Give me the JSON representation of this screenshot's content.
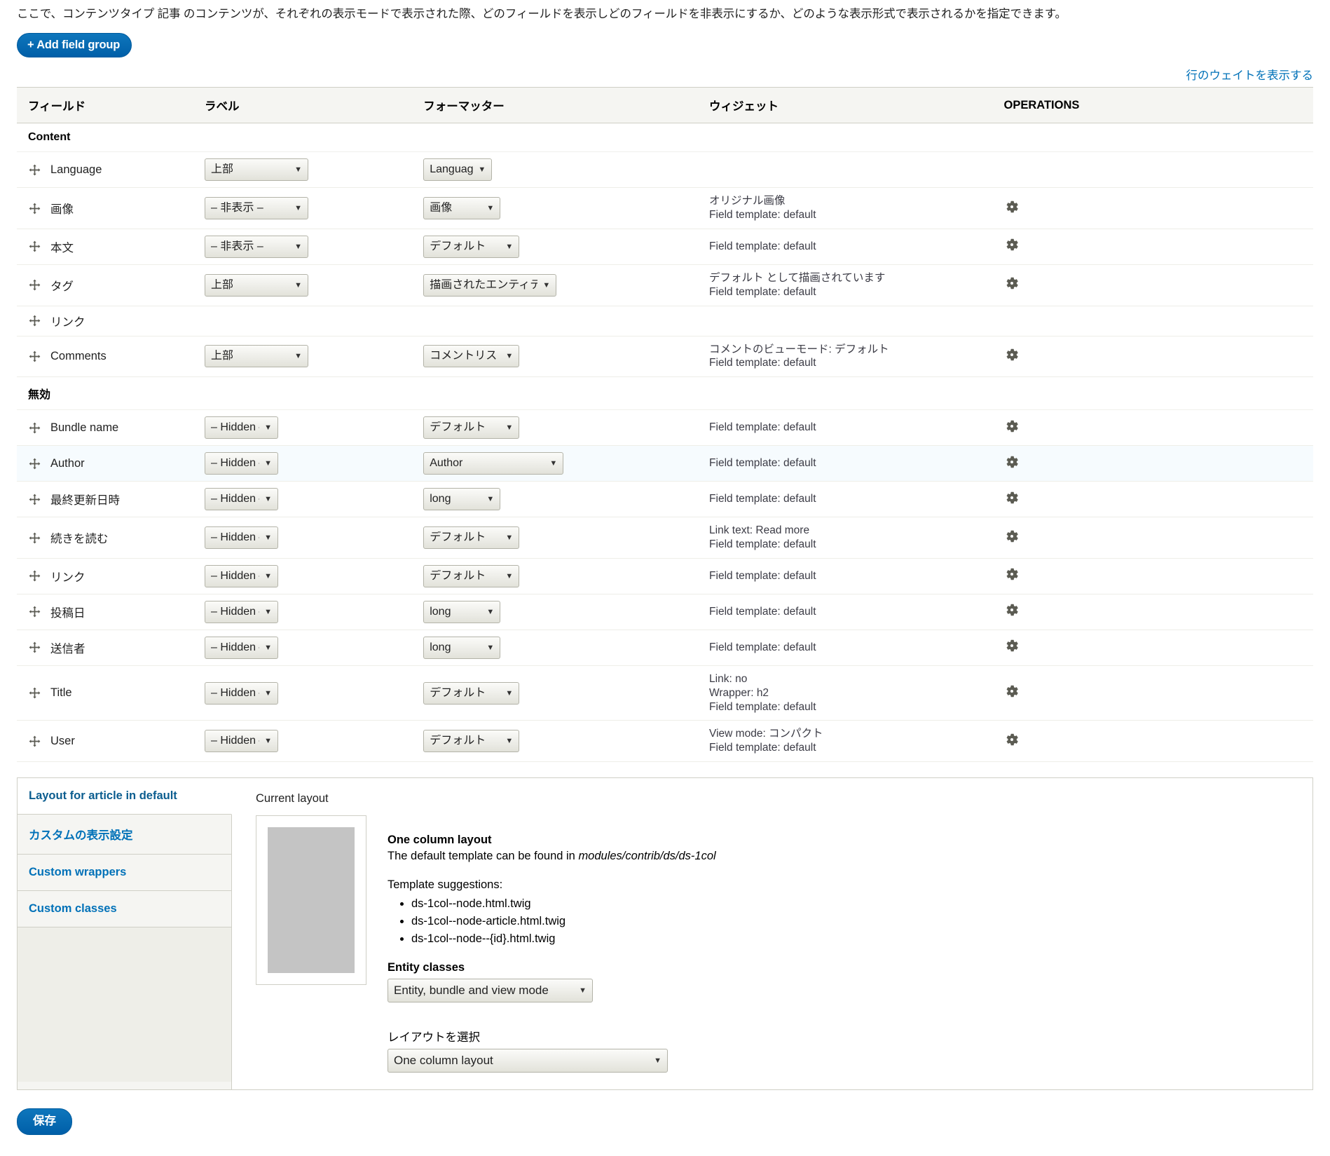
{
  "intro": "ここで、コンテンツタイプ 記事 のコンテンツが、それぞれの表示モードで表示された際、どのフィールドを表示しどのフィールドを非表示にするか、どのような表示形式で表示されるかを指定できます。",
  "toolbar": {
    "add_field_group_label": "+ Add field group",
    "show_row_weights_label": "行のウェイトを表示する"
  },
  "table": {
    "headers": {
      "field": "フィールド",
      "label": "ラベル",
      "formatter": "フォーマッター",
      "widget": "ウィジェット",
      "operations": "OPERATIONS"
    },
    "regions": [
      {
        "name": "Content"
      },
      {
        "name": "無効"
      }
    ],
    "rows": [
      {
        "region": "Content",
        "field": "Language",
        "label_select": "上部",
        "formatter_select": "Language",
        "widget_lines": [],
        "has_gear": false,
        "highlight": false,
        "label_width": "wide",
        "formatter_width": "sm"
      },
      {
        "region": "Content",
        "field": "画像",
        "label_select": "– 非表示 –",
        "formatter_select": "画像",
        "widget_lines": [
          "オリジナル画像",
          "Field template: default"
        ],
        "has_gear": true,
        "highlight": false,
        "label_width": "wide",
        "formatter_width": "md"
      },
      {
        "region": "Content",
        "field": "本文",
        "label_select": "– 非表示 –",
        "formatter_select": "デフォルト",
        "widget_lines": [
          "Field template: default"
        ],
        "has_gear": true,
        "highlight": false,
        "label_width": "wide",
        "formatter_width": "lg"
      },
      {
        "region": "Content",
        "field": "タグ",
        "label_select": "上部",
        "formatter_select": "描画されたエンティティ",
        "widget_lines": [
          "デフォルト として描画されています",
          "Field template: default"
        ],
        "has_gear": true,
        "highlight": false,
        "label_width": "wide",
        "formatter_width": "xl"
      },
      {
        "region": "Content",
        "field": "リンク",
        "label_select": null,
        "formatter_select": null,
        "widget_lines": [],
        "has_gear": false,
        "highlight": false,
        "label_width": "wide",
        "formatter_width": "lg"
      },
      {
        "region": "Content",
        "field": "Comments",
        "label_select": "上部",
        "formatter_select": "コメントリスト",
        "widget_lines": [
          "コメントのビューモード: デフォルト",
          "Field template: default"
        ],
        "has_gear": true,
        "highlight": false,
        "label_width": "wide",
        "formatter_width": "lg"
      },
      {
        "region": "無効",
        "field": "Bundle name",
        "label_select": "– Hidden –",
        "formatter_select": "デフォルト",
        "widget_lines": [
          "Field template: default"
        ],
        "has_gear": true,
        "highlight": false,
        "label_width": "narrow",
        "formatter_width": "lg"
      },
      {
        "region": "無効",
        "field": "Author",
        "label_select": "– Hidden –",
        "formatter_select": "Author",
        "widget_lines": [
          "Field template: default"
        ],
        "has_gear": true,
        "highlight": true,
        "label_width": "narrow",
        "formatter_width": "xxl"
      },
      {
        "region": "無効",
        "field": "最終更新日時",
        "label_select": "– Hidden –",
        "formatter_select": "long",
        "widget_lines": [
          "Field template: default"
        ],
        "has_gear": true,
        "highlight": false,
        "label_width": "narrow",
        "formatter_width": "md"
      },
      {
        "region": "無効",
        "field": "続きを読む",
        "label_select": "– Hidden –",
        "formatter_select": "デフォルト",
        "widget_lines": [
          "Link text: Read more",
          "Field template: default"
        ],
        "has_gear": true,
        "highlight": false,
        "label_width": "narrow",
        "formatter_width": "lg"
      },
      {
        "region": "無効",
        "field": "リンク",
        "label_select": "– Hidden –",
        "formatter_select": "デフォルト",
        "widget_lines": [
          "Field template: default"
        ],
        "has_gear": true,
        "highlight": false,
        "label_width": "narrow",
        "formatter_width": "lg"
      },
      {
        "region": "無効",
        "field": "投稿日",
        "label_select": "– Hidden –",
        "formatter_select": "long",
        "widget_lines": [
          "Field template: default"
        ],
        "has_gear": true,
        "highlight": false,
        "label_width": "narrow",
        "formatter_width": "md"
      },
      {
        "region": "無効",
        "field": "送信者",
        "label_select": "– Hidden –",
        "formatter_select": "long",
        "widget_lines": [
          "Field template: default"
        ],
        "has_gear": true,
        "highlight": false,
        "label_width": "narrow",
        "formatter_width": "md"
      },
      {
        "region": "無効",
        "field": "Title",
        "label_select": "– Hidden –",
        "formatter_select": "デフォルト",
        "widget_lines": [
          "Link: no",
          "Wrapper: h2",
          "Field template: default"
        ],
        "has_gear": true,
        "highlight": false,
        "label_width": "narrow",
        "formatter_width": "lg"
      },
      {
        "region": "無効",
        "field": "User",
        "label_select": "– Hidden –",
        "formatter_select": "デフォルト",
        "widget_lines": [
          "View mode: コンパクト",
          "Field template: default"
        ],
        "has_gear": true,
        "highlight": false,
        "label_width": "narrow",
        "formatter_width": "lg"
      }
    ]
  },
  "vertical_tabs": {
    "items": [
      {
        "label": "Layout for article in default",
        "active": true
      },
      {
        "label": "カスタムの表示設定",
        "active": false
      },
      {
        "label": "Custom wrappers",
        "active": false
      },
      {
        "label": "Custom classes",
        "active": false
      }
    ]
  },
  "layout_pane": {
    "current_layout_heading": "Current layout",
    "layout_title": "One column layout",
    "layout_desc_prefix": "The default template can be found in ",
    "layout_desc_path": "modules/contrib/ds/ds-1col",
    "template_suggestions_heading": "Template suggestions:",
    "template_suggestions": [
      "ds-1col--node.html.twig",
      "ds-1col--node-article.html.twig",
      "ds-1col--node--{id}.html.twig"
    ],
    "entity_classes_heading": "Entity classes",
    "entity_classes_value": "Entity, bundle and view mode",
    "select_layout_heading": "レイアウトを選択",
    "select_layout_value": "One column layout"
  },
  "footer": {
    "save_label": "保存"
  },
  "colors": {
    "accent_blue": "#0071b8",
    "link_blue": "#0071b8",
    "header_bg": "#f5f5f2",
    "highlight_row": "#f6fbfe"
  }
}
